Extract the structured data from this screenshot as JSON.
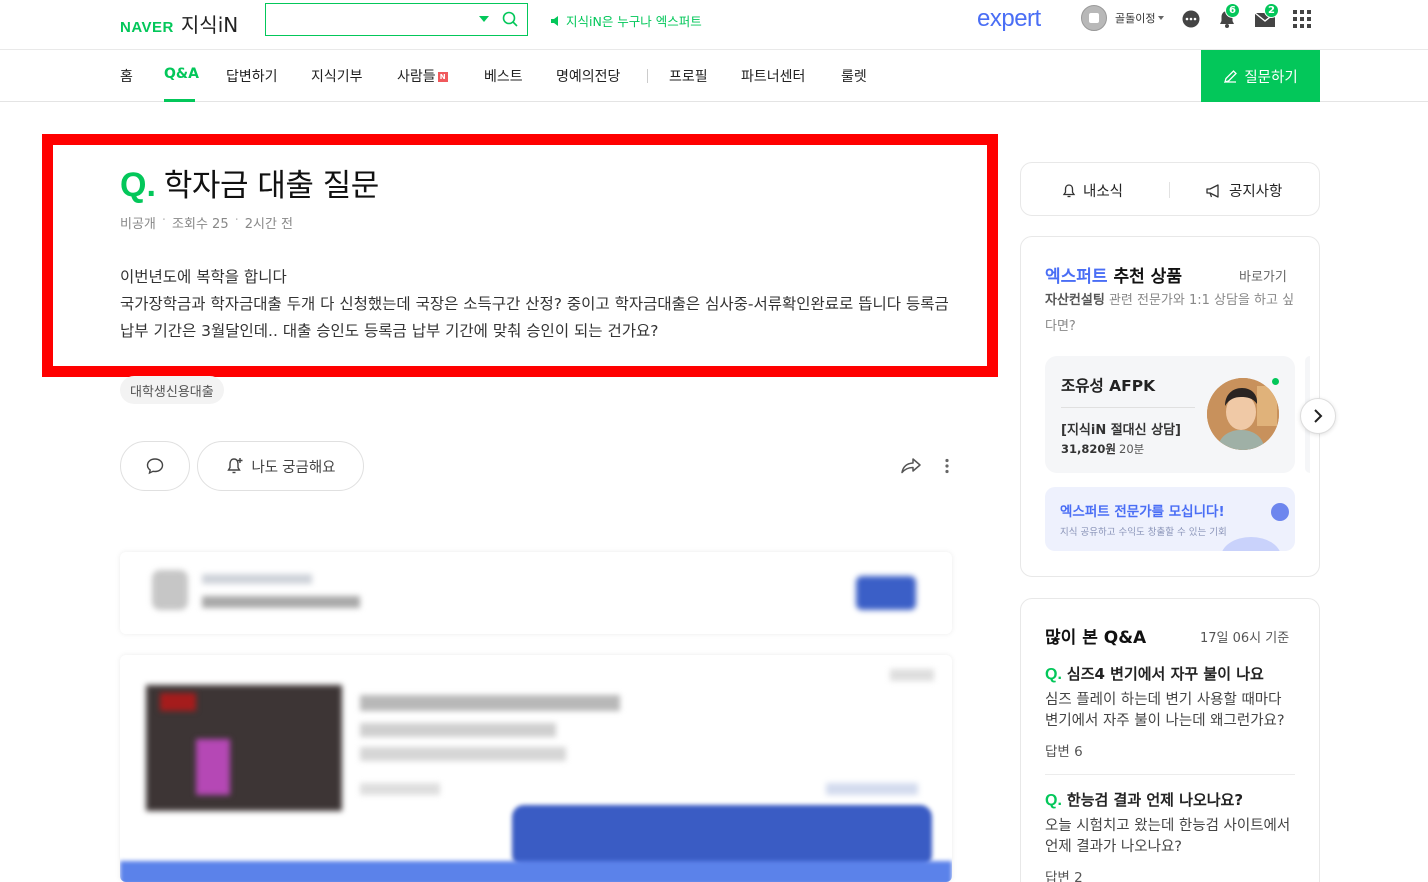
{
  "header": {
    "brand_naver": "NAVER",
    "brand_jisikin": "지식iN",
    "search_placeholder": "",
    "promo_text": "지식iN은 누구나 엑스퍼트",
    "expert_logo": "expert",
    "username": "골돌이정",
    "chat_badge": "",
    "notification_badge": "6",
    "mail_badge": "2"
  },
  "nav": {
    "items": [
      "홈",
      "Q&A",
      "답변하기",
      "지식기부",
      "사람들",
      "베스트",
      "명예의전당",
      "프로필",
      "파트너센터",
      "룰렛"
    ],
    "new_badge": "N",
    "ask_button": "질문하기"
  },
  "question": {
    "q_mark": "Q.",
    "title": "학자금 대출 질문",
    "visibility": "비공개",
    "views": "조회수 25",
    "time": "2시간 전",
    "body_line1": "이번년도에 복학을 합니다",
    "body_line2": "국가장학금과 학자금대출 두개 다 신청했는데 국장은 소득구간 산정? 중이고 학자금대출은 심사중-서류확인완료로 뜹니다 등록금 납부 기간은 3월달인데.. 대출 승인도 등록금 납부 기간에 맞춰 승인이 되는 건가요?",
    "tag": "대학생신용대출",
    "curious_button": "나도 궁금해요"
  },
  "sidebar": {
    "my_news": "내소식",
    "notice": "공지사항",
    "rec_title_highlight": "엑스퍼트",
    "rec_title_rest": " 추천 상품",
    "rec_link": "바로가기",
    "rec_desc_bold": "자산컨설팅",
    "rec_desc_rest": " 관련 전문가와 1:1 상담을 하고 싶다면?",
    "expert_name": "조유성 AFPK",
    "expert_product": "[지식iN 절대신 상담]",
    "expert_price": "31,820원",
    "expert_time": "20분",
    "recruit_title": "엑스퍼트 전문가를 모십니다!",
    "recruit_sub": "지식 공유하고 수익도 창출할 수 있는 기회",
    "popular_title": "많이 본 Q&A",
    "popular_time": "17일 06시 기준",
    "popular": [
      {
        "q": "심즈4 변기에서 자꾸 불이 나요",
        "body": "심즈 플레이 하는데 변기 사용할 때마다 변기에서 자주 불이 나는데 왜그런가요?",
        "answers": "답변 6"
      },
      {
        "q": "한능검 결과 언제 나오나요?",
        "body": "오늘 시험치고 왔는데 한능검 사이트에서 언제 결과가 나오나요?",
        "answers": "답변 2"
      }
    ]
  },
  "colors": {
    "brand_green": "#03c75a",
    "expert_blue": "#4a6ef5",
    "highlight_red": "#ff0000"
  }
}
